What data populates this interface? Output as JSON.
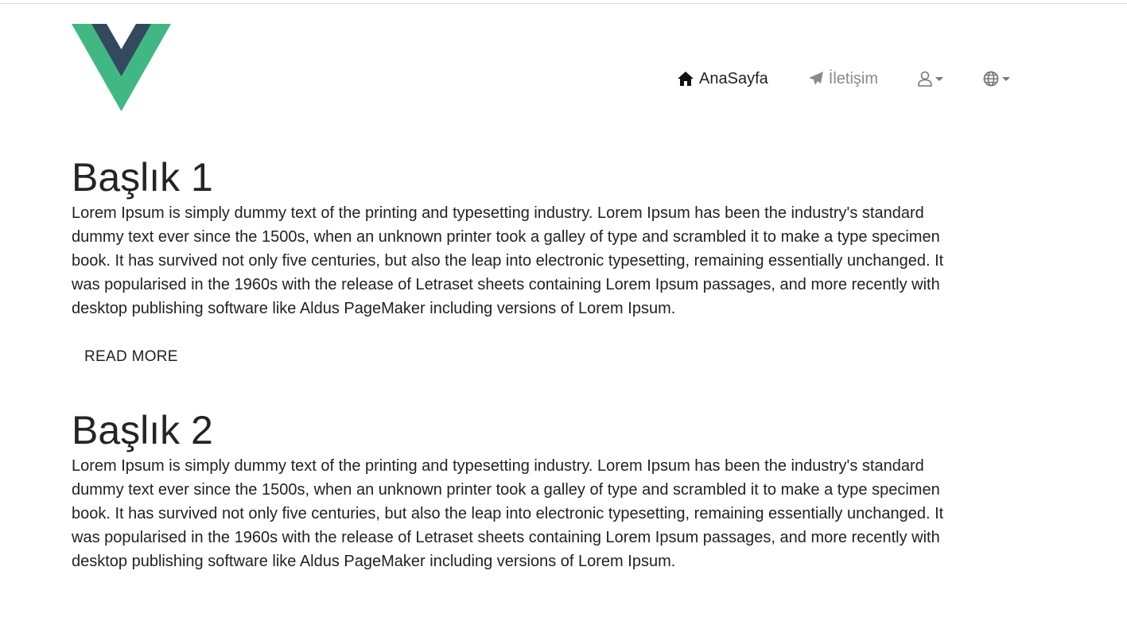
{
  "header": {
    "logo_name": "vue-logo",
    "nav": {
      "home_label": "AnaSayfa",
      "contact_label": "İletişim",
      "user_icon": "user-icon",
      "language_icon": "globe-icon"
    }
  },
  "articles": [
    {
      "title": "Başlık 1",
      "body": "Lorem Ipsum is simply dummy text of the printing and typesetting industry. Lorem Ipsum has been the industry's standard dummy text ever since the 1500s, when an unknown printer took a galley of type and scrambled it to make a type specimen book. It has survived not only five centuries, but also the leap into electronic typesetting, remaining essentially unchanged. It was popularised in the 1960s with the release of Letraset sheets containing Lorem Ipsum passages, and more recently with desktop publishing software like Aldus PageMaker including versions of Lorem Ipsum.",
      "read_more": "READ MORE"
    },
    {
      "title": "Başlık 2",
      "body": "Lorem Ipsum is simply dummy text of the printing and typesetting industry. Lorem Ipsum has been the industry's standard dummy text ever since the 1500s, when an unknown printer took a galley of type and scrambled it to make a type specimen book. It has survived not only five centuries, but also the leap into electronic typesetting, remaining essentially unchanged. It was popularised in the 1960s with the release of Letraset sheets containing Lorem Ipsum passages, and more recently with desktop publishing software like Aldus PageMaker including versions of Lorem Ipsum."
    }
  ],
  "colors": {
    "vue_green": "#41b883",
    "vue_dark": "#34495e",
    "text": "#222222",
    "muted": "#8a8a8a"
  }
}
